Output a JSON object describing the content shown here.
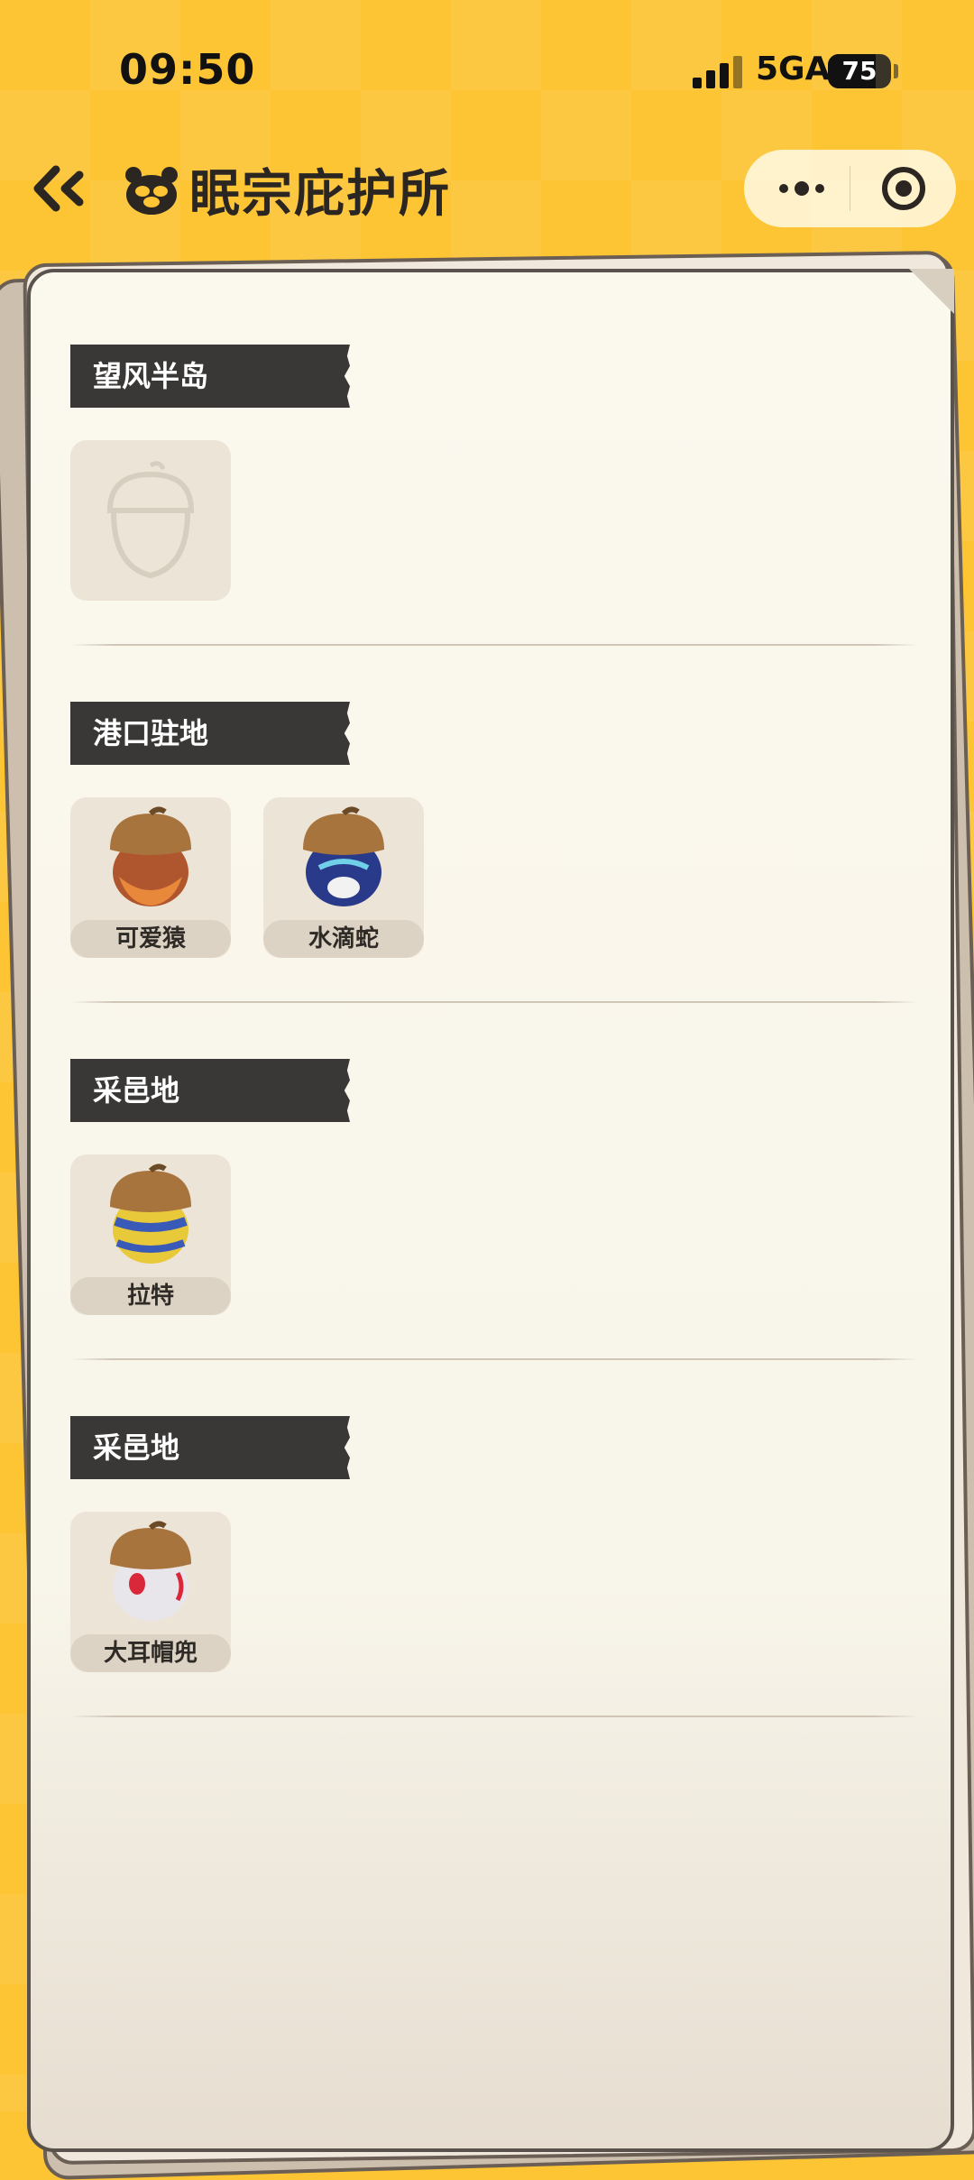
{
  "status_bar": {
    "time": "09:50",
    "network": "5GA",
    "battery": "75"
  },
  "nav": {
    "title": "眠宗庇护所"
  },
  "sections": [
    {
      "region": "望风半岛",
      "items": []
    },
    {
      "region": "港口驻地",
      "items": [
        {
          "name": "可爱猿",
          "color": "#b0562e"
        },
        {
          "name": "水滴蛇",
          "color": "#2a3a8a"
        }
      ]
    },
    {
      "region": "采邑地",
      "items": [
        {
          "name": "拉特",
          "color": "#e8c93a"
        }
      ]
    },
    {
      "region": "采邑地",
      "items": [
        {
          "name": "大耳帽兜",
          "color": "#e8e6ea"
        }
      ]
    }
  ],
  "colors": {
    "background": "#fdc433",
    "banner": "#3a3836",
    "paper": "#fbf8ee"
  }
}
